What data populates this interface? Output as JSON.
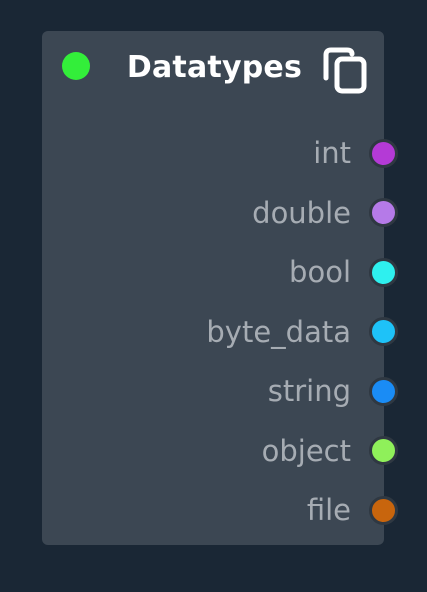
{
  "node": {
    "title": "Datatypes",
    "status_color": "#33ee3a",
    "copy_icon": "copy-icon"
  },
  "ports": [
    {
      "label": "int",
      "color": "#b43ad6"
    },
    {
      "label": "double",
      "color": "#b57ae8"
    },
    {
      "label": "bool",
      "color": "#2ef0ef"
    },
    {
      "label": "byte_data",
      "color": "#1ec2f8"
    },
    {
      "label": "string",
      "color": "#1a8cf5"
    },
    {
      "label": "object",
      "color": "#8ff05a"
    },
    {
      "label": "file",
      "color": "#c8650d"
    }
  ]
}
